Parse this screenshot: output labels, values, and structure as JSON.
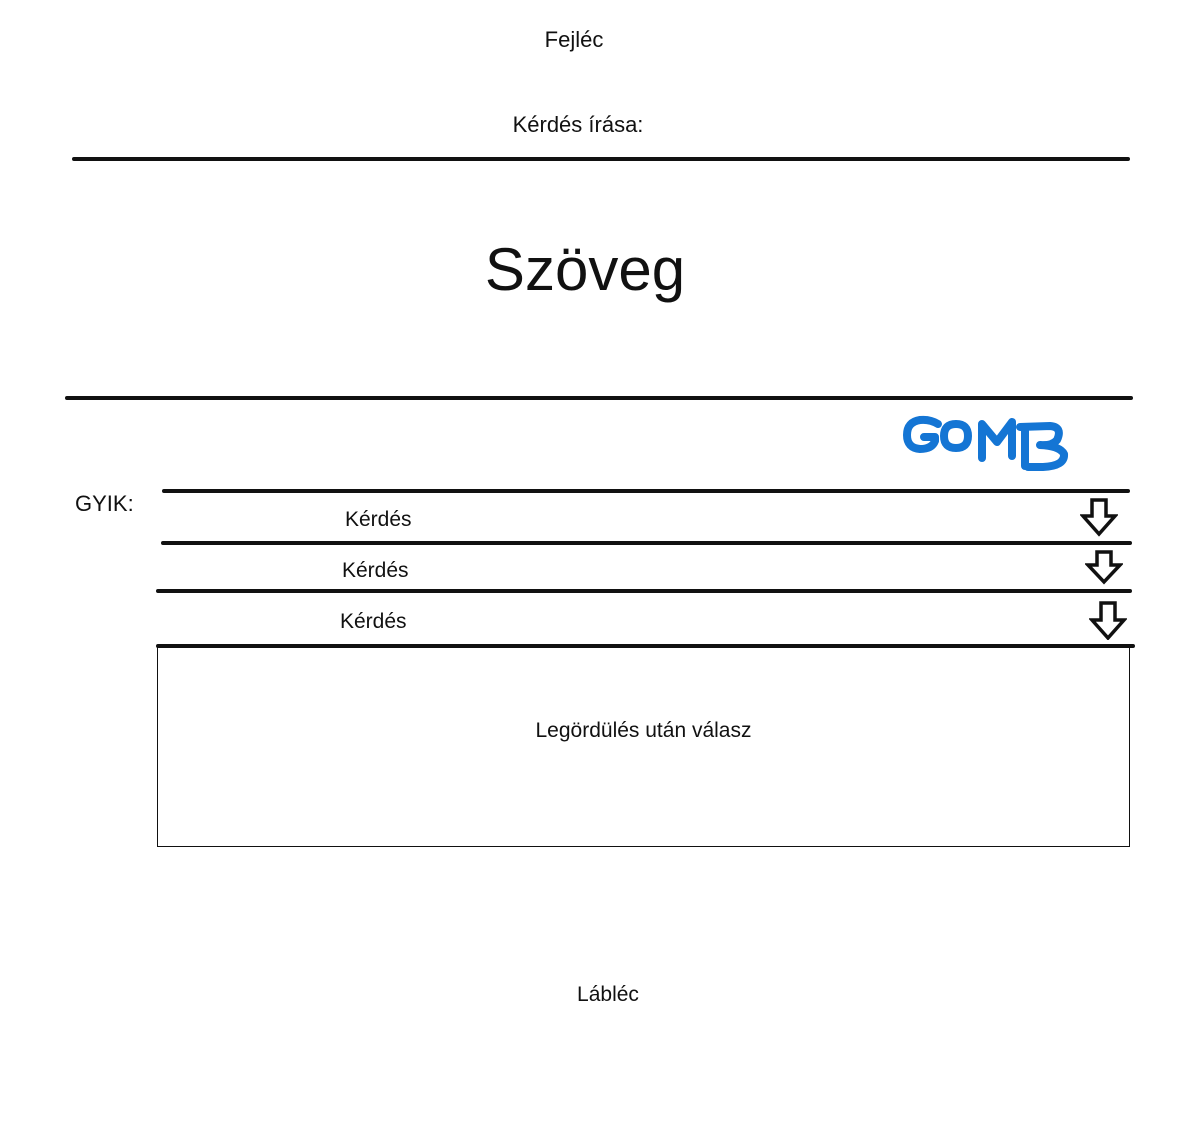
{
  "header": {
    "title": "Fejléc"
  },
  "question_form": {
    "label": "Kérdés írása:",
    "textarea_text": "Szöveg",
    "submit_label": "GOMB",
    "submit_color": "#1475d4"
  },
  "faq": {
    "label": "GYIK:",
    "items": [
      {
        "question": "Kérdés",
        "icon": "arrow-down-icon"
      },
      {
        "question": "Kérdés",
        "icon": "arrow-down-icon"
      },
      {
        "question": "Kérdés",
        "icon": "arrow-down-icon"
      }
    ],
    "answer": "Legördülés után válasz"
  },
  "footer": {
    "text": "Lábléc"
  }
}
